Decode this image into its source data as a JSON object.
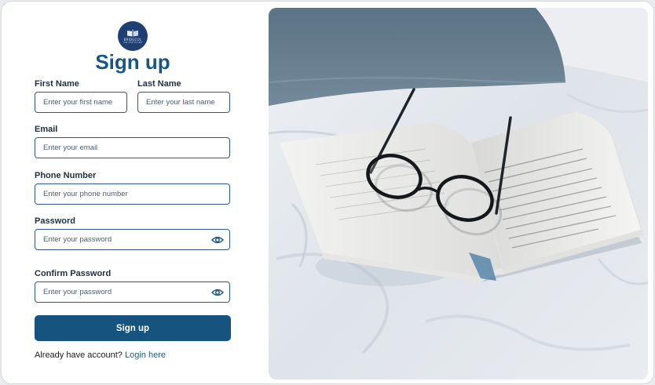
{
  "brand": {
    "logo_name": "BRIDGCOL",
    "logo_tagline": "FOR YOUR FUTURE"
  },
  "form": {
    "title": "Sign up",
    "first_name": {
      "label": "First Name",
      "placeholder": "Enter your first name"
    },
    "last_name": {
      "label": "Last Name",
      "placeholder": "Enter your last name"
    },
    "email": {
      "label": "Email",
      "placeholder": "Enter your email"
    },
    "phone": {
      "label": "Phone Number",
      "placeholder": "Enter your phone number"
    },
    "password": {
      "label": "Password",
      "placeholder": "Enter your password"
    },
    "confirm_password": {
      "label": "Confirm Password",
      "placeholder": "Enter your password"
    },
    "submit_label": "Sign up",
    "footer_text": "Already have account?",
    "login_link": "Login here"
  },
  "colors": {
    "primary": "#16537e",
    "title": "#15578a",
    "field_border": "#2d5a83",
    "logo_bg": "#1e3f73"
  },
  "icons": {
    "password_toggle": "eye-icon",
    "logo": "book-logo-icon"
  },
  "image": {
    "subject": "open book with reading glasses on bed"
  }
}
